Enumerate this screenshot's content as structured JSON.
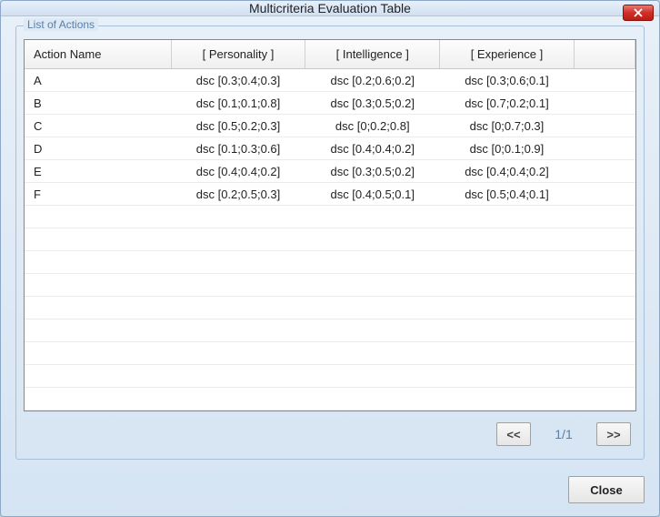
{
  "window": {
    "title": "Multicriteria Evaluation Table"
  },
  "group": {
    "label": "List of Actions"
  },
  "table": {
    "headers": {
      "action": "Action Name",
      "personality": "[ Personality ]",
      "intelligence": "[ Intelligence ]",
      "experience": "[ Experience ]"
    },
    "rows": [
      {
        "action": "A",
        "personality": "dsc [0.3;0.4;0.3]",
        "intelligence": "dsc [0.2;0.6;0.2]",
        "experience": "dsc [0.3;0.6;0.1]"
      },
      {
        "action": "B",
        "personality": "dsc [0.1;0.1;0.8]",
        "intelligence": "dsc [0.3;0.5;0.2]",
        "experience": "dsc [0.7;0.2;0.1]"
      },
      {
        "action": "C",
        "personality": "dsc [0.5;0.2;0.3]",
        "intelligence": "dsc [0;0.2;0.8]",
        "experience": "dsc [0;0.7;0.3]"
      },
      {
        "action": "D",
        "personality": "dsc [0.1;0.3;0.6]",
        "intelligence": "dsc [0.4;0.4;0.2]",
        "experience": "dsc [0;0.1;0.9]"
      },
      {
        "action": "E",
        "personality": "dsc [0.4;0.4;0.2]",
        "intelligence": "dsc [0.3;0.5;0.2]",
        "experience": "dsc [0.4;0.4;0.2]"
      },
      {
        "action": "F",
        "personality": "dsc [0.2;0.5;0.3]",
        "intelligence": "dsc [0.4;0.5;0.1]",
        "experience": "dsc [0.5;0.4;0.1]"
      }
    ],
    "empty_rows": 9
  },
  "pager": {
    "prev": "<<",
    "info": "1/1",
    "next": ">>"
  },
  "footer": {
    "close": "Close"
  }
}
